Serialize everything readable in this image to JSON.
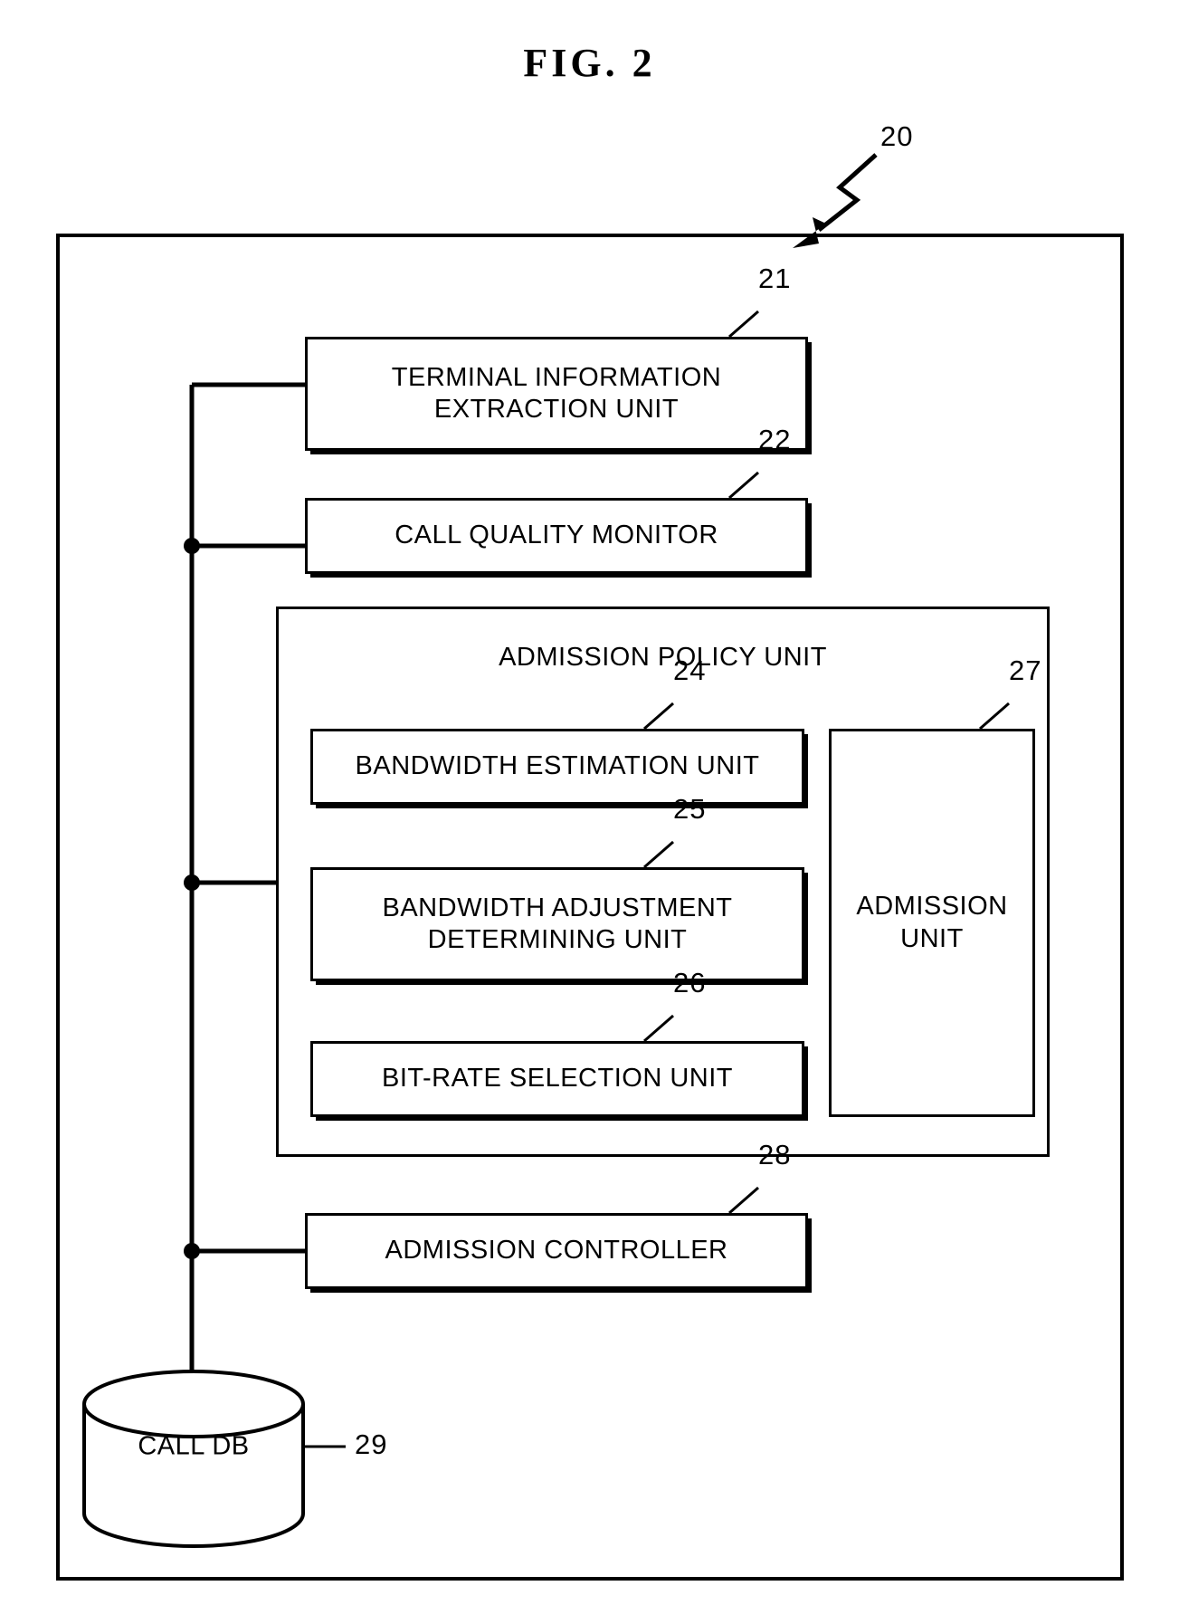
{
  "figure": {
    "title": "FIG.  2",
    "system_ref": "20"
  },
  "blocks": [
    {
      "id": "terminal-information-extraction-unit",
      "label": "TERMINAL INFORMATION\nEXTRACTION UNIT",
      "ref": "21"
    },
    {
      "id": "call-quality-monitor",
      "label": "CALL QUALITY MONITOR",
      "ref": "22"
    },
    {
      "id": "admission-policy-unit",
      "label": "ADMISSION POLICY UNIT",
      "ref": ""
    },
    {
      "id": "bandwidth-estimation-unit",
      "label": "BANDWIDTH ESTIMATION UNIT",
      "ref": "24"
    },
    {
      "id": "bandwidth-adjustment-determining-unit",
      "label": "BANDWIDTH ADJUSTMENT\nDETERMINING UNIT",
      "ref": "25"
    },
    {
      "id": "bit-rate-selection-unit",
      "label": "BIT-RATE SELECTION UNIT",
      "ref": "26"
    },
    {
      "id": "admission-unit",
      "label": "ADMISSION\nUNIT",
      "ref": "27"
    },
    {
      "id": "admission-controller",
      "label": "ADMISSION CONTROLLER",
      "ref": "28"
    },
    {
      "id": "call-db",
      "label": "CALL DB",
      "ref": "29"
    }
  ],
  "colors": {
    "stroke": "#000000",
    "background": "#ffffff"
  }
}
